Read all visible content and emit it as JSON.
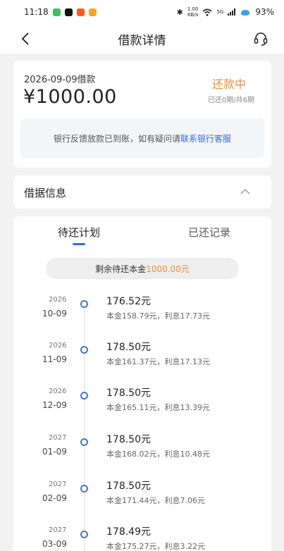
{
  "status_bar": {
    "time": "11:18",
    "net_speed_value": "1.00",
    "net_speed_unit": "KB/s",
    "network": "5G",
    "battery": "93%"
  },
  "nav": {
    "title": "借款详情"
  },
  "summary": {
    "date_label": "2026-09-09借款",
    "amount": "¥1000.00",
    "status": "还款中",
    "progress": "已还0期/共6期",
    "notice_prefix": "银行反馈放款已到账，如有疑问请",
    "notice_link": "联系银行客服"
  },
  "receipt_info": {
    "title": "借据信息"
  },
  "plan": {
    "tabs": [
      "待还计划",
      "已还记录"
    ],
    "remaining_prefix": "剩余待还本金",
    "remaining_amount": "1000.00元",
    "rows": [
      {
        "year": "2026",
        "md": "10-09",
        "total": "176.52元",
        "breakdown": "本金158.79元，利息17.73元"
      },
      {
        "year": "2026",
        "md": "11-09",
        "total": "178.50元",
        "breakdown": "本金161.37元，利息17.13元"
      },
      {
        "year": "2026",
        "md": "12-09",
        "total": "178.50元",
        "breakdown": "本金165.11元，利息13.39元"
      },
      {
        "year": "2027",
        "md": "01-09",
        "total": "178.50元",
        "breakdown": "本金168.02元，利息10.48元"
      },
      {
        "year": "2027",
        "md": "02-09",
        "total": "178.50元",
        "breakdown": "本金171.44元，利息7.06元"
      },
      {
        "year": "2027",
        "md": "03-09",
        "total": "178.49元",
        "breakdown": "本金175.27元，利息3.22元"
      }
    ]
  },
  "colors": {
    "accent_blue": "#2e6fd8",
    "accent_orange": "#e8903a",
    "background": "#f2f2f2"
  }
}
